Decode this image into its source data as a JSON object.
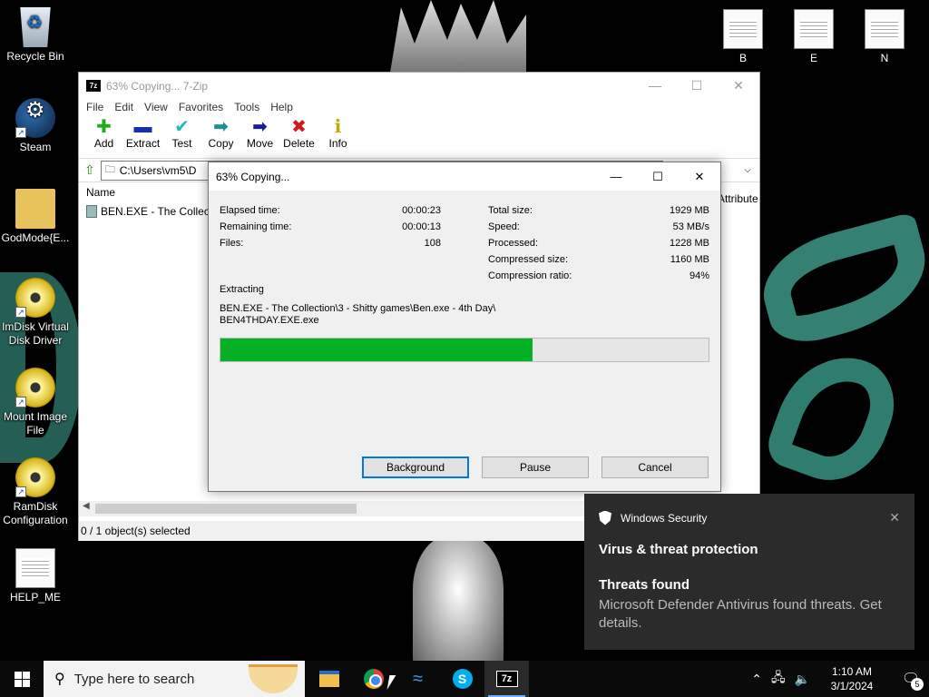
{
  "desktop": {
    "left_icons": [
      {
        "name": "recycle-bin-icon",
        "label": "Recycle Bin"
      },
      {
        "name": "steam-icon",
        "label": "Steam"
      },
      {
        "name": "folder-icon",
        "label": "GodMode{E..."
      },
      {
        "name": "disc-icon",
        "label": "ImDisk Virtual Disk Driver"
      },
      {
        "name": "disc-icon",
        "label": "Mount Image File"
      },
      {
        "name": "disc-icon",
        "label": "RamDisk Configuration"
      },
      {
        "name": "document-icon",
        "label": "HELP_ME"
      }
    ],
    "right_icons": [
      {
        "name": "document-icon",
        "label": "B"
      },
      {
        "name": "document-icon",
        "label": "E"
      },
      {
        "name": "document-icon",
        "label": "N"
      }
    ]
  },
  "main_window": {
    "title": "63% Copying... 7-Zip",
    "app_icon": "7z",
    "menu": [
      "File",
      "Edit",
      "View",
      "Favorites",
      "Tools",
      "Help"
    ],
    "toolbar": [
      {
        "label": "Add",
        "icon": "plus-icon",
        "glyph": "✚",
        "color": "#1faa1f"
      },
      {
        "label": "Extract",
        "icon": "minus-icon",
        "glyph": "▬",
        "color": "#1a2fb0"
      },
      {
        "label": "Test",
        "icon": "check-icon",
        "glyph": "✔",
        "color": "#22b8c8"
      },
      {
        "label": "Copy",
        "icon": "copy-arrow-icon",
        "glyph": "➡",
        "color": "#1f8f8f"
      },
      {
        "label": "Move",
        "icon": "move-arrow-icon",
        "glyph": "➡",
        "color": "#1a1f90"
      },
      {
        "label": "Delete",
        "icon": "delete-x-icon",
        "glyph": "✖",
        "color": "#d01a1a"
      },
      {
        "label": "Info",
        "icon": "info-icon",
        "glyph": "ℹ",
        "color": "#c8a800"
      }
    ],
    "address": "C:\\Users\\vm5\\D",
    "column_name": "Name",
    "column_attributes": "Attribute",
    "file_row": "BEN.EXE - The Collecti",
    "status": "0 / 1 object(s) selected"
  },
  "dialog": {
    "title": "63% Copying...",
    "left_stats": [
      {
        "label": "Elapsed time:",
        "value": "00:00:23"
      },
      {
        "label": "Remaining time:",
        "value": "00:00:13"
      },
      {
        "label": "Files:",
        "value": "108"
      }
    ],
    "right_stats": [
      {
        "label": "Total size:",
        "value": "1929 MB"
      },
      {
        "label": "Speed:",
        "value": "53 MB/s"
      },
      {
        "label": "Processed:",
        "value": "1228 MB"
      },
      {
        "label": "Compressed size:",
        "value": "1160 MB"
      },
      {
        "label": "Compression ratio:",
        "value": "94%"
      }
    ],
    "action": "Extracting",
    "path_line1": "BEN.EXE - The Collection\\3 - Shitty games\\Ben.exe - 4th Day\\",
    "path_line2": "BEN4THDAY.EXE.exe",
    "progress_fraction": 0.64,
    "progress_color": "#06b025",
    "buttons": {
      "background": "Background",
      "pause": "Pause",
      "cancel": "Cancel"
    }
  },
  "toast": {
    "app": "Windows Security",
    "title": "Virus & threat protection",
    "subtitle": "Threats found",
    "body": "Microsoft Defender Antivirus found threats. Get details."
  },
  "taskbar": {
    "search_placeholder": "Type here to search",
    "time": "1:10 AM",
    "date": "3/1/2024",
    "notification_count": "5"
  }
}
